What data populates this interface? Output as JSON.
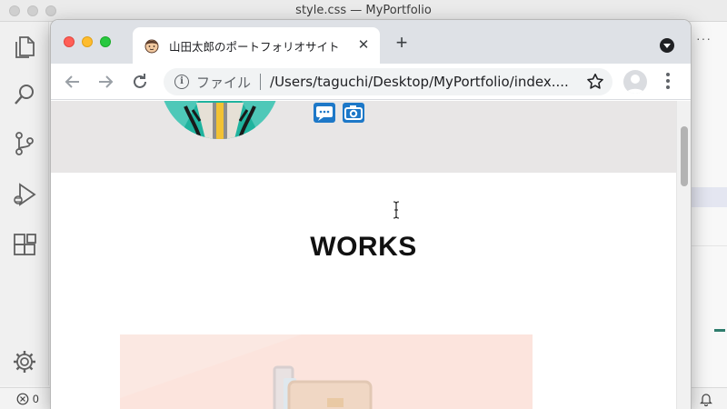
{
  "vscode": {
    "title": "style.css — MyPortfolio",
    "more_label": "···",
    "status": {
      "errors": "0"
    }
  },
  "browser": {
    "tab": {
      "title": "山田太郎のポートフォリオサイト",
      "close_label": "✕"
    },
    "new_tab_label": "+",
    "omnibox": {
      "chip": "ファイル",
      "url": "/Users/taguchi/Desktop/MyPortfolio/index...."
    }
  },
  "page": {
    "section_title": "WORKS"
  },
  "colors": {
    "hero_bg": "#e8e6e6",
    "avatar_bg": "#4ec8b8",
    "sns_blue": "#1d78c8",
    "work_thumb_bg": "#fce4dd"
  }
}
